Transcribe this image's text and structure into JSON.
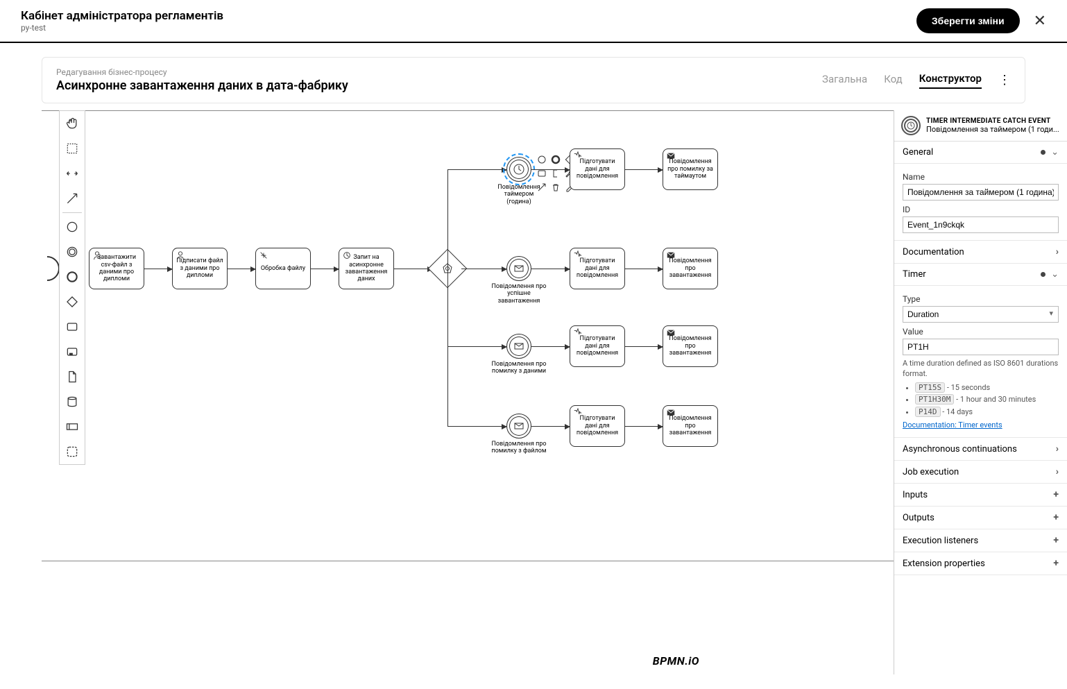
{
  "header": {
    "title": "Кабінет адміністратора регламентів",
    "subtitle": "py-test",
    "save": "Зберегти зміни"
  },
  "process": {
    "breadcrumb": "Редагування бізнес-процесу",
    "title": "Асинхронне завантаження даних в дата-фабрику",
    "tabs": {
      "general": "Загальна",
      "code": "Код",
      "constructor": "Конструктор"
    }
  },
  "tasks": {
    "upload": "Завантажити csv-файл з даними про дипломи",
    "sign": "Підписати файл з даними про дипломи",
    "process": "Обробка файлу",
    "request": "Запит на асинхронне завантаження даних",
    "prepare1": "Підготувати дані для повідомлення",
    "notify_timeout": "Повідомлення про помилку за таймаутом",
    "prepare2": "Підготувати дані для повідомлення",
    "notify_upload2": "Повідомлення про завантаження",
    "prepare3": "Підготувати дані для повідомлення",
    "notify_upload3": "Повідомлення про завантаження",
    "prepare4": "Підготувати дані для повідомлення",
    "notify_upload4": "Повідомлення про завантаження"
  },
  "events": {
    "timer": "Повідомлення таймером (година)",
    "success": "Повідомлення про успішне завантаження",
    "data_error": "Повідомлення про помилку з даними",
    "file_error": "Повідомлення про помилку з файлом"
  },
  "props": {
    "type_label": "TIMER INTERMEDIATE CATCH EVENT",
    "element_name": "Повідомлення за таймером (1 годи...",
    "sections": {
      "general": "General",
      "documentation": "Documentation",
      "timer": "Timer",
      "async": "Asynchronous continuations",
      "job": "Job execution",
      "inputs": "Inputs",
      "outputs": "Outputs",
      "listeners": "Execution listeners",
      "ext": "Extension properties"
    },
    "fields": {
      "name_label": "Name",
      "name_value": "Повідомлення за таймером (1 година)",
      "id_label": "ID",
      "id_value": "Event_1n9ckqk",
      "timer_type_label": "Type",
      "timer_type_value": "Duration",
      "timer_value_label": "Value",
      "timer_value": "PT1H",
      "help_intro": "A time duration defined as ISO 8601 durations format.",
      "ex1_code": "PT15S",
      "ex1_text": " - 15 seconds",
      "ex2_code": "PT1H30M",
      "ex2_text": " - 1 hour and 30 minutes",
      "ex3_code": "P14D",
      "ex3_text": " - 14 days",
      "doc_link": "Documentation: Timer events"
    }
  },
  "watermark": "BPMN.iO"
}
